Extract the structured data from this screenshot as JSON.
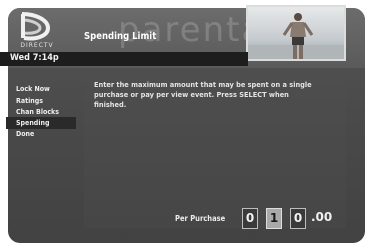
{
  "header": {
    "watermark": "parental",
    "brand": "DIRECTV",
    "clock": "Wed 7:14p",
    "title": "Spending Limit"
  },
  "sidebar": {
    "items": [
      {
        "label": "Lock Now"
      },
      {
        "label": "Ratings"
      },
      {
        "label": "Chan Blocks"
      },
      {
        "label": "Spending"
      },
      {
        "label": "Done"
      }
    ],
    "selected": "Spending"
  },
  "content": {
    "instructions": "Enter the maximum amount that may be spent on a single purchase or pay per view event. Press SELECT when finished.",
    "per_purchase_label": "Per Purchase",
    "digits": [
      "0",
      "1",
      "0"
    ],
    "cents": ".00"
  },
  "colors": {
    "background": "#4a4a4a",
    "highlight": "#2a2a2a",
    "text": "#efefef"
  },
  "icons": [
    "directv-logo-icon"
  ]
}
